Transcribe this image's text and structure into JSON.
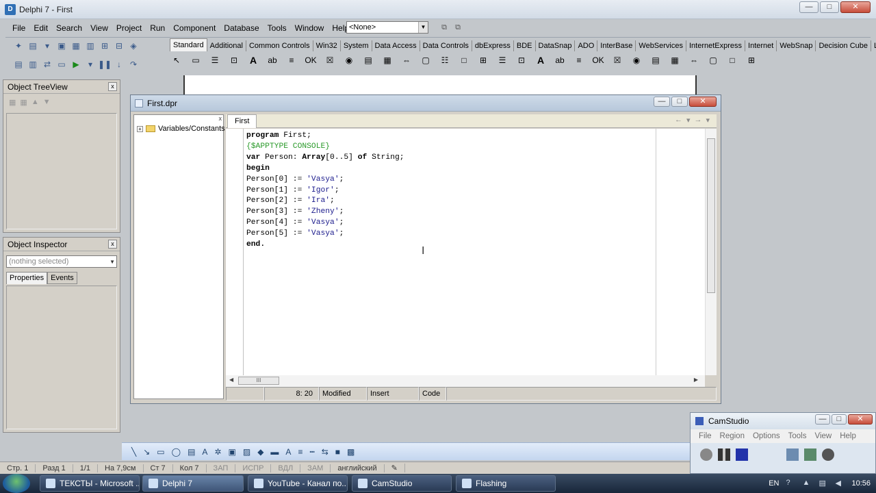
{
  "window": {
    "title": "Delphi 7 - First",
    "min": "—",
    "max": "□",
    "close": "✕"
  },
  "menu": [
    "File",
    "Edit",
    "Search",
    "View",
    "Project",
    "Run",
    "Component",
    "Database",
    "Tools",
    "Window",
    "Help"
  ],
  "toolbar": {
    "desktop_combo": "<None>"
  },
  "palette": {
    "tabs": [
      "Standard",
      "Additional",
      "Common Controls",
      "Win32",
      "System",
      "Data Access",
      "Data Controls",
      "dbExpress",
      "BDE",
      "DataSnap",
      "ADO",
      "InterBase",
      "WebServices",
      "InternetExpress",
      "Internet",
      "WebSnap",
      "Decision Cube",
      "L"
    ]
  },
  "tree_view": {
    "title": "Object TreeView",
    "close": "x"
  },
  "inspector": {
    "title": "Object Inspector",
    "close": "x",
    "selection": "(nothing selected)",
    "tabs": [
      "Properties",
      "Events"
    ]
  },
  "editor": {
    "title": "First.dpr",
    "explorer_close": "x",
    "explorer_node": "Variables/Constants",
    "tab": "First",
    "nav_back": "←",
    "nav_fwd": "→",
    "scroll_thumb": "III",
    "status": {
      "position": "8: 20",
      "modified": "Modified",
      "mode": "Insert",
      "view": "Code"
    },
    "code": [
      {
        "segments": [
          {
            "t": "program ",
            "c": "kw"
          },
          {
            "t": "First;",
            "c": ""
          }
        ]
      },
      {
        "segments": [
          {
            "t": "{$APPTYPE CONSOLE}",
            "c": "dir"
          }
        ]
      },
      {
        "segments": [
          {
            "t": "var ",
            "c": "kw"
          },
          {
            "t": "Person: ",
            "c": ""
          },
          {
            "t": "Array",
            "c": "kw"
          },
          {
            "t": "[0..5] ",
            "c": ""
          },
          {
            "t": "of ",
            "c": "kw"
          },
          {
            "t": "String;",
            "c": ""
          }
        ]
      },
      {
        "segments": [
          {
            "t": "begin",
            "c": "kw"
          }
        ]
      },
      {
        "segments": [
          {
            "t": "Person[0] := ",
            "c": ""
          },
          {
            "t": "'Vasya'",
            "c": "str"
          },
          {
            "t": ";",
            "c": ""
          }
        ]
      },
      {
        "segments": [
          {
            "t": "Person[1] := ",
            "c": ""
          },
          {
            "t": "'Igor'",
            "c": "str"
          },
          {
            "t": ";",
            "c": ""
          }
        ]
      },
      {
        "segments": [
          {
            "t": "Person[2] := ",
            "c": ""
          },
          {
            "t": "'Ira'",
            "c": "str"
          },
          {
            "t": ";",
            "c": ""
          }
        ]
      },
      {
        "segments": [
          {
            "t": "Person[3] := ",
            "c": ""
          },
          {
            "t": "'Zheny'",
            "c": "str"
          },
          {
            "t": ";",
            "c": ""
          }
        ]
      },
      {
        "segments": [
          {
            "t": "Person[4] := ",
            "c": ""
          },
          {
            "t": "'Vasya'",
            "c": "str"
          },
          {
            "t": ";",
            "c": ""
          }
        ]
      },
      {
        "segments": [
          {
            "t": "Person[5] := ",
            "c": ""
          },
          {
            "t": "'Vasya'",
            "c": "str"
          },
          {
            "t": ";",
            "c": ""
          }
        ]
      },
      {
        "segments": [
          {
            "t": "end.",
            "c": "kw"
          }
        ]
      }
    ]
  },
  "word_status": [
    "Стр. 1",
    "Разд 1",
    "1/1",
    "На 7,9см",
    "Ст 7",
    "Кол 7",
    "ЗАП",
    "ИСПР",
    "ВДЛ",
    "ЗАМ",
    "английский"
  ],
  "camstudio": {
    "title": "CamStudio",
    "menu": [
      "File",
      "Region",
      "Options",
      "Tools",
      "View",
      "Help"
    ]
  },
  "taskbar": {
    "tasks": [
      "ТЕКСТЫ - Microsoft ...",
      "Delphi 7",
      "YouTube - Канал по...",
      "CamStudio",
      "Flashing"
    ],
    "lang": "EN",
    "clock": "10:56"
  }
}
